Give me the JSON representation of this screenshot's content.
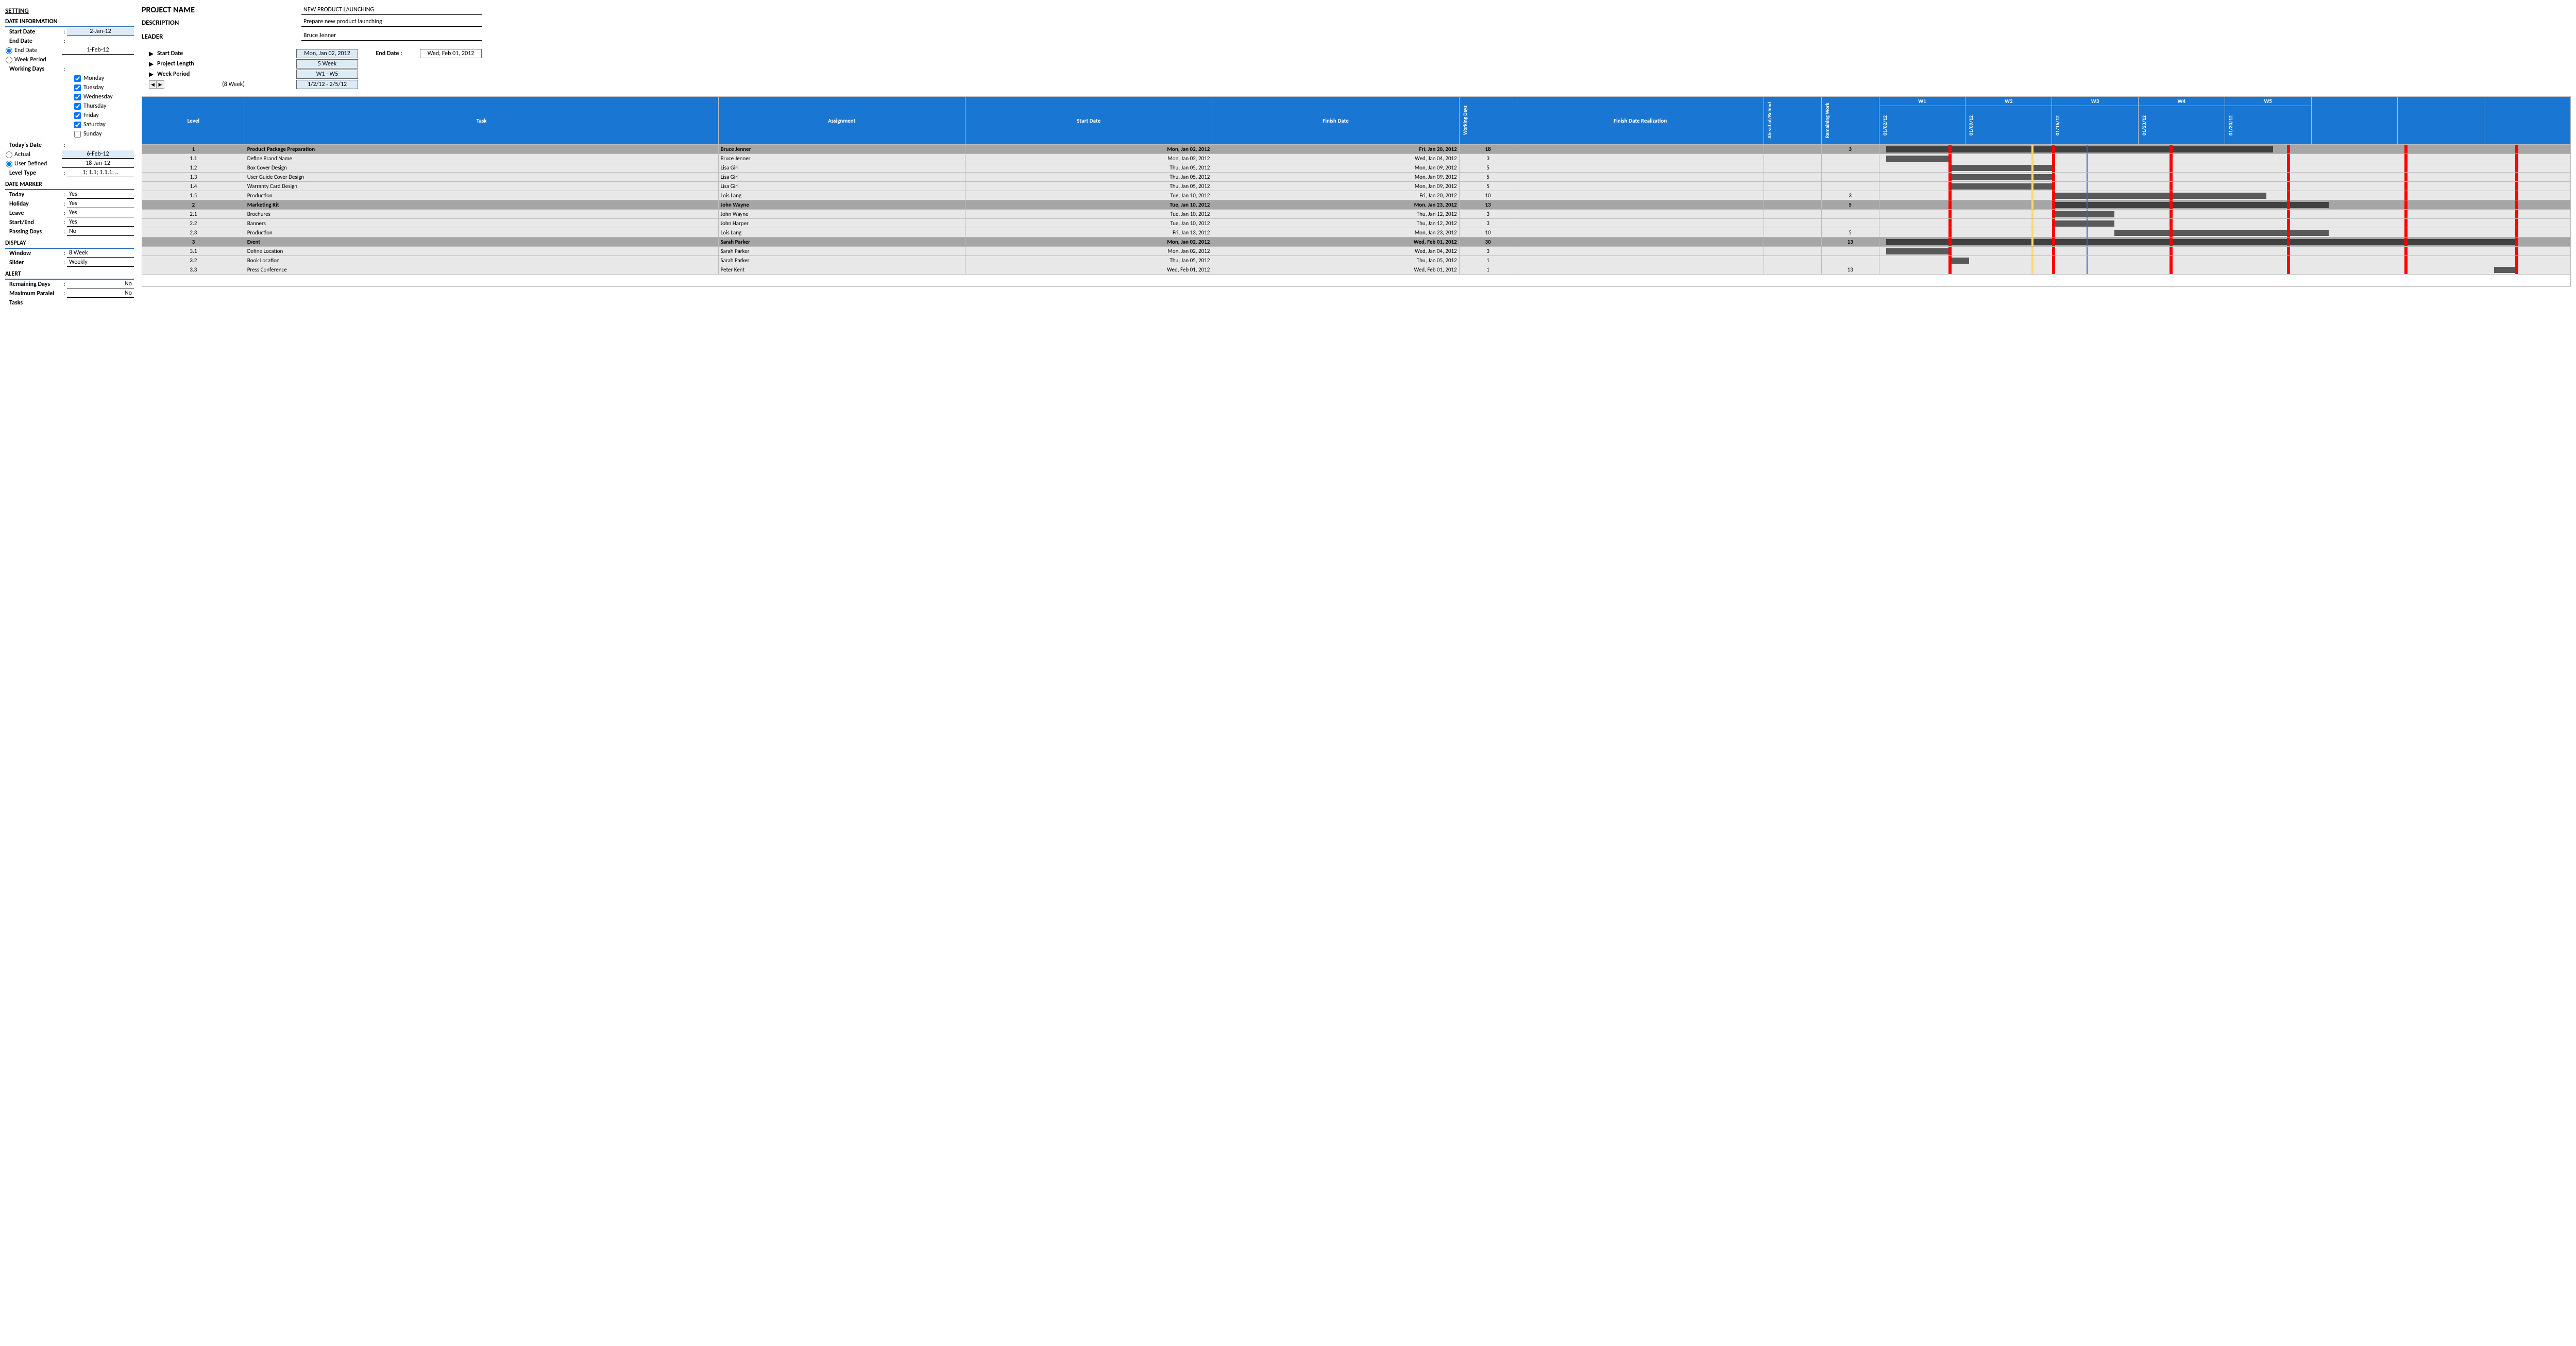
{
  "sidebar": {
    "title": "SETTING",
    "date_info_title": "DATE INFORMATION",
    "start_date_lbl": "Start Date",
    "start_date": "2-Jan-12",
    "end_date_lbl": "End Date",
    "end_date_radio_lbl": "End Date",
    "end_date": "1-Feb-12",
    "week_period_radio_lbl": "Week Period",
    "working_days_lbl": "Working Days",
    "days": [
      {
        "label": "Monday",
        "on": true
      },
      {
        "label": "Tuesday",
        "on": true
      },
      {
        "label": "Wednesday",
        "on": true
      },
      {
        "label": "Thursday",
        "on": true
      },
      {
        "label": "Friday",
        "on": true
      },
      {
        "label": "Saturday",
        "on": true
      },
      {
        "label": "Sunday",
        "on": false
      }
    ],
    "todays_date_lbl": "Today's Date",
    "actual_lbl": "Actual",
    "actual_val": "6-Feb-12",
    "user_def_lbl": "User Defined",
    "user_def_val": "18-Jan-12",
    "level_type_lbl": "Level Type",
    "level_type_val": "1; 1.1; 1.1.1; ..",
    "date_marker_title": "DATE MARKER",
    "today_lbl": "Today",
    "today_val": "Yes",
    "holiday_lbl": "Holiday",
    "holiday_val": "Yes",
    "leave_lbl": "Leave",
    "leave_val": "Yes",
    "startend_lbl": "Start/End",
    "startend_val": "Yes",
    "passing_lbl": "Passing Days",
    "passing_val": "No",
    "display_title": "DISPLAY",
    "window_lbl": "Window",
    "window_val": "8 Week",
    "slider_lbl": "Slider",
    "slider_val": "Weekly",
    "alert_title": "ALERT",
    "remaining_lbl": "Remaining Days",
    "remaining_val": "No",
    "maxpar_lbl": "Maximum Paralel",
    "maxpar_val": "No",
    "tasks_lbl": "Tasks"
  },
  "header": {
    "name_lbl": "PROJECT NAME",
    "name_val": "NEW PRODUCT LAUNCHING",
    "desc_lbl": "DESCRIPTION",
    "desc_val": "Prepare new product launching",
    "leader_lbl": "LEADER",
    "leader_val": "Bruce Jenner",
    "start_lbl": "Start Date",
    "start_val": "Mon, Jan 02, 2012",
    "len_lbl": "Project Length",
    "len_val": "5 Week",
    "wp_lbl": "Week Period",
    "wp_val": "W1 - W5",
    "scroll_lbl": "(8 Week)",
    "scroll_val": "1/2/12 - 2/5/12",
    "end_lbl": "End Date :",
    "end_val": "Wed, Feb 01, 2012"
  },
  "grid": {
    "cols": {
      "level": "Level",
      "task": "Task",
      "assignment": "Assignment",
      "start": "Start Date",
      "finish": "Finish Date",
      "wd": "Working Days",
      "fr": "Finish Date Realization",
      "ab": "Ahead of/Behind",
      "rw": "Remaining Work"
    },
    "weeks": [
      "W1",
      "W2",
      "W3",
      "W4",
      "W5"
    ],
    "dates": [
      "01/02/12",
      "01/09/12",
      "01/16/12",
      "01/23/12",
      "01/30/12"
    ],
    "rows": [
      {
        "type": "parent",
        "level": "1",
        "task": "Product Package Preparation",
        "asg": "Bruce Jenner",
        "sd": "Mon, Jan 02, 2012",
        "fd": "Fri, Jan 20, 2012",
        "wd": "18",
        "rw": "3",
        "bar": {
          "l": 1,
          "w": 56
        }
      },
      {
        "type": "child",
        "level": "1.1",
        "task": "Define Brand Name",
        "asg": "Bruce Jenner",
        "sd": "Mon, Jan 02, 2012",
        "fd": "Wed, Jan 04, 2012",
        "wd": "3",
        "rw": "",
        "bar": {
          "l": 1,
          "w": 9
        }
      },
      {
        "type": "child",
        "level": "1.2",
        "task": "Box Cover Design",
        "asg": "Lisa Girl",
        "sd": "Thu, Jan 05, 2012",
        "fd": "Mon, Jan 09, 2012",
        "wd": "5",
        "rw": "",
        "bar": {
          "l": 10,
          "w": 15
        }
      },
      {
        "type": "child",
        "level": "1.3",
        "task": "User Guide Cover Design",
        "asg": "Lisa Girl",
        "sd": "Thu, Jan 05, 2012",
        "fd": "Mon, Jan 09, 2012",
        "wd": "5",
        "rw": "",
        "bar": {
          "l": 10,
          "w": 15
        }
      },
      {
        "type": "child",
        "level": "1.4",
        "task": "Warranty Card Design",
        "asg": "Lisa Girl",
        "sd": "Thu, Jan 05, 2012",
        "fd": "Mon, Jan 09, 2012",
        "wd": "5",
        "rw": "",
        "bar": {
          "l": 10,
          "w": 15
        }
      },
      {
        "type": "child",
        "level": "1.5",
        "task": "Production",
        "asg": "Lois Lang",
        "sd": "Tue, Jan 10, 2012",
        "fd": "Fri, Jan 20, 2012",
        "wd": "10",
        "rw": "3",
        "bar": {
          "l": 25,
          "w": 31
        }
      },
      {
        "type": "parent",
        "level": "2",
        "task": "Marketing Kit",
        "asg": "John Wayne",
        "sd": "Tue, Jan 10, 2012",
        "fd": "Mon, Jan 23, 2012",
        "wd": "13",
        "rw": "5",
        "bar": {
          "l": 25,
          "w": 40
        }
      },
      {
        "type": "child",
        "level": "2.1",
        "task": "Brochures",
        "asg": "John Wayne",
        "sd": "Tue, Jan 10, 2012",
        "fd": "Thu, Jan 12, 2012",
        "wd": "3",
        "rw": "",
        "bar": {
          "l": 25,
          "w": 9
        }
      },
      {
        "type": "child",
        "level": "2.2",
        "task": "Banners",
        "asg": "John Harper",
        "sd": "Tue, Jan 10, 2012",
        "fd": "Thu, Jan 12, 2012",
        "wd": "3",
        "rw": "",
        "bar": {
          "l": 25,
          "w": 9
        }
      },
      {
        "type": "child",
        "level": "2.3",
        "task": "Production",
        "asg": "Lois Lang",
        "sd": "Fri, Jan 13, 2012",
        "fd": "Mon, Jan 23, 2012",
        "wd": "10",
        "rw": "5",
        "bar": {
          "l": 34,
          "w": 31
        }
      },
      {
        "type": "parent",
        "level": "3",
        "task": "Event",
        "asg": "Sarah Parker",
        "sd": "Mon, Jan 02, 2012",
        "fd": "Wed, Feb 01, 2012",
        "wd": "30",
        "rw": "13",
        "bar": {
          "l": 1,
          "w": 91
        }
      },
      {
        "type": "child",
        "level": "3.1",
        "task": "Define Location",
        "asg": "Sarah Parker",
        "sd": "Mon, Jan 02, 2012",
        "fd": "Wed, Jan 04, 2012",
        "wd": "3",
        "rw": "",
        "bar": {
          "l": 1,
          "w": 9
        }
      },
      {
        "type": "child",
        "level": "3.2",
        "task": "Book Location",
        "asg": "Sarah Parker",
        "sd": "Thu, Jan 05, 2012",
        "fd": "Thu, Jan 05, 2012",
        "wd": "1",
        "rw": "",
        "bar": {
          "l": 10,
          "w": 3
        }
      },
      {
        "type": "child",
        "level": "3.3",
        "task": "Press Conference",
        "asg": "Peter Kent",
        "sd": "Wed, Feb 01, 2012",
        "fd": "Wed, Feb 01, 2012",
        "wd": "1",
        "rw": "13",
        "bar": {
          "l": 89,
          "w": 3
        }
      }
    ],
    "markers": {
      "red": [
        10,
        25,
        42,
        59,
        76,
        92
      ],
      "yellow": [
        22
      ],
      "blue": [
        30
      ]
    }
  }
}
